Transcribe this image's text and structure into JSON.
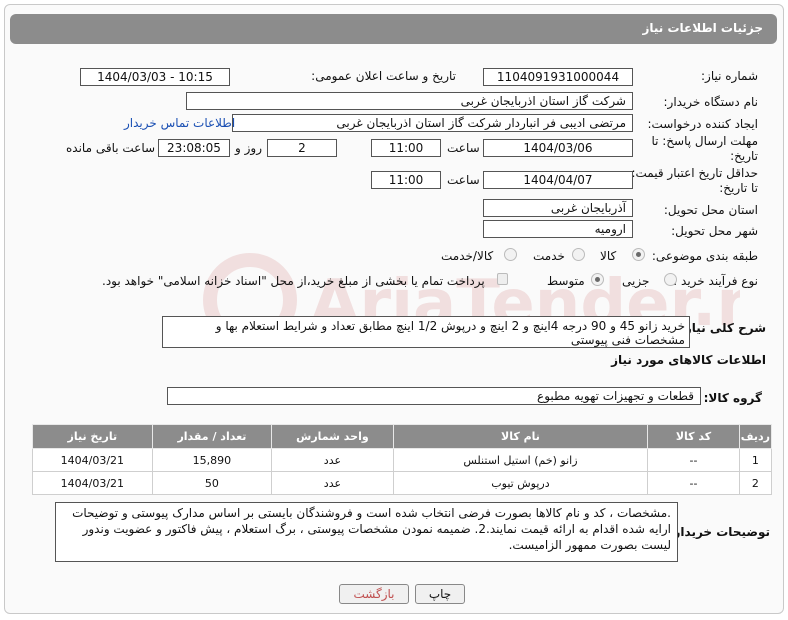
{
  "header": {
    "title": "جزئیات اطلاعات نیاز"
  },
  "fields": {
    "need_number_label": "شماره نیاز:",
    "need_number": "1104091931000044",
    "announce_label": "تاریخ و ساعت اعلان عمومی:",
    "announce_value": "1404/03/03 - 10:15",
    "buyer_org_label": "نام دستگاه خریدار:",
    "buyer_org": "شرکت گاز استان اذربایجان غربی",
    "requester_label": "ایجاد کننده درخواست:",
    "requester": "مرتضی ادیبی فر انباردار شرکت گاز استان اذربایجان غربی",
    "contact_link": "اطلاعات تماس خریدار",
    "deadline_label_1": "مهلت ارسال پاسخ: تا",
    "deadline_label_2": "تاریخ:",
    "deadline_date": "1404/03/06",
    "time_label": "ساعت",
    "deadline_time": "11:00",
    "days_value": "2",
    "days_label": "روز و",
    "remaining_value": "23:08:05",
    "remaining_label": "ساعت باقی مانده",
    "validity_label_1": "حداقل تاریخ اعتبار قیمت:",
    "validity_label_2": "تا تاریخ:",
    "validity_date": "1404/04/07",
    "validity_time": "11:00",
    "province_label": "استان محل تحویل:",
    "province": "آذربایجان غربی",
    "city_label": "شهر محل تحویل:",
    "city": "ارومیه",
    "category_label": "طبقه بندی موضوعی:",
    "cat_goods": "کالا",
    "cat_service": "خدمت",
    "cat_both": "کالا/خدمت",
    "process_label": "نوع فرآیند خرید :",
    "proc_partial": "جزیی",
    "proc_medium": "متوسط",
    "payment_note": "پرداخت تمام یا بخشی از مبلغ خرید،از محل \"اسناد خزانه اسلامی\" خواهد بود.",
    "description_label": "شرح کلی نیاز:",
    "description": "خرید زانو 45 و 90 درجه 4اینچ و 2 اینچ و درپوش 1/2 اینچ مطابق تعداد و شرایط استعلام بها و مشخصات فنی پیوستی",
    "goods_info_title": "اطلاعات کالاهای مورد نیاز",
    "goods_group_label": "گروه کالا:",
    "goods_group": "قطعات و تجهیزات تهویه مطبوع",
    "buyer_notes_label": "توضیحات خریدار:",
    "buyer_notes": ".مشخصات ، کد و نام کالاها بصورت فرضی انتخاب شده است و فروشندگان بایستی بر اساس مدارک پیوستی و توضیحات ارایه شده اقدام به ارائه قیمت نمایند.2. ضمیمه نمودن مشخصات پیوستی ، برگ استعلام ، پیش فاکتور و عضویت وندور لیست بصورت ممهور الزامیست."
  },
  "table": {
    "headers": [
      "ردیف",
      "کد کالا",
      "نام کالا",
      "واحد شمارش",
      "تعداد / مقدار",
      "تاریخ نیاز"
    ],
    "rows": [
      [
        "1",
        "--",
        "زانو (خم) استیل استنلس",
        "عدد",
        "15,890",
        "1404/03/21"
      ],
      [
        "2",
        "--",
        "درپوش تیوب",
        "عدد",
        "50",
        "1404/03/21"
      ]
    ]
  },
  "buttons": {
    "print": "چاپ",
    "back": "بازگشت"
  },
  "watermark": "AriaTender.neT"
}
